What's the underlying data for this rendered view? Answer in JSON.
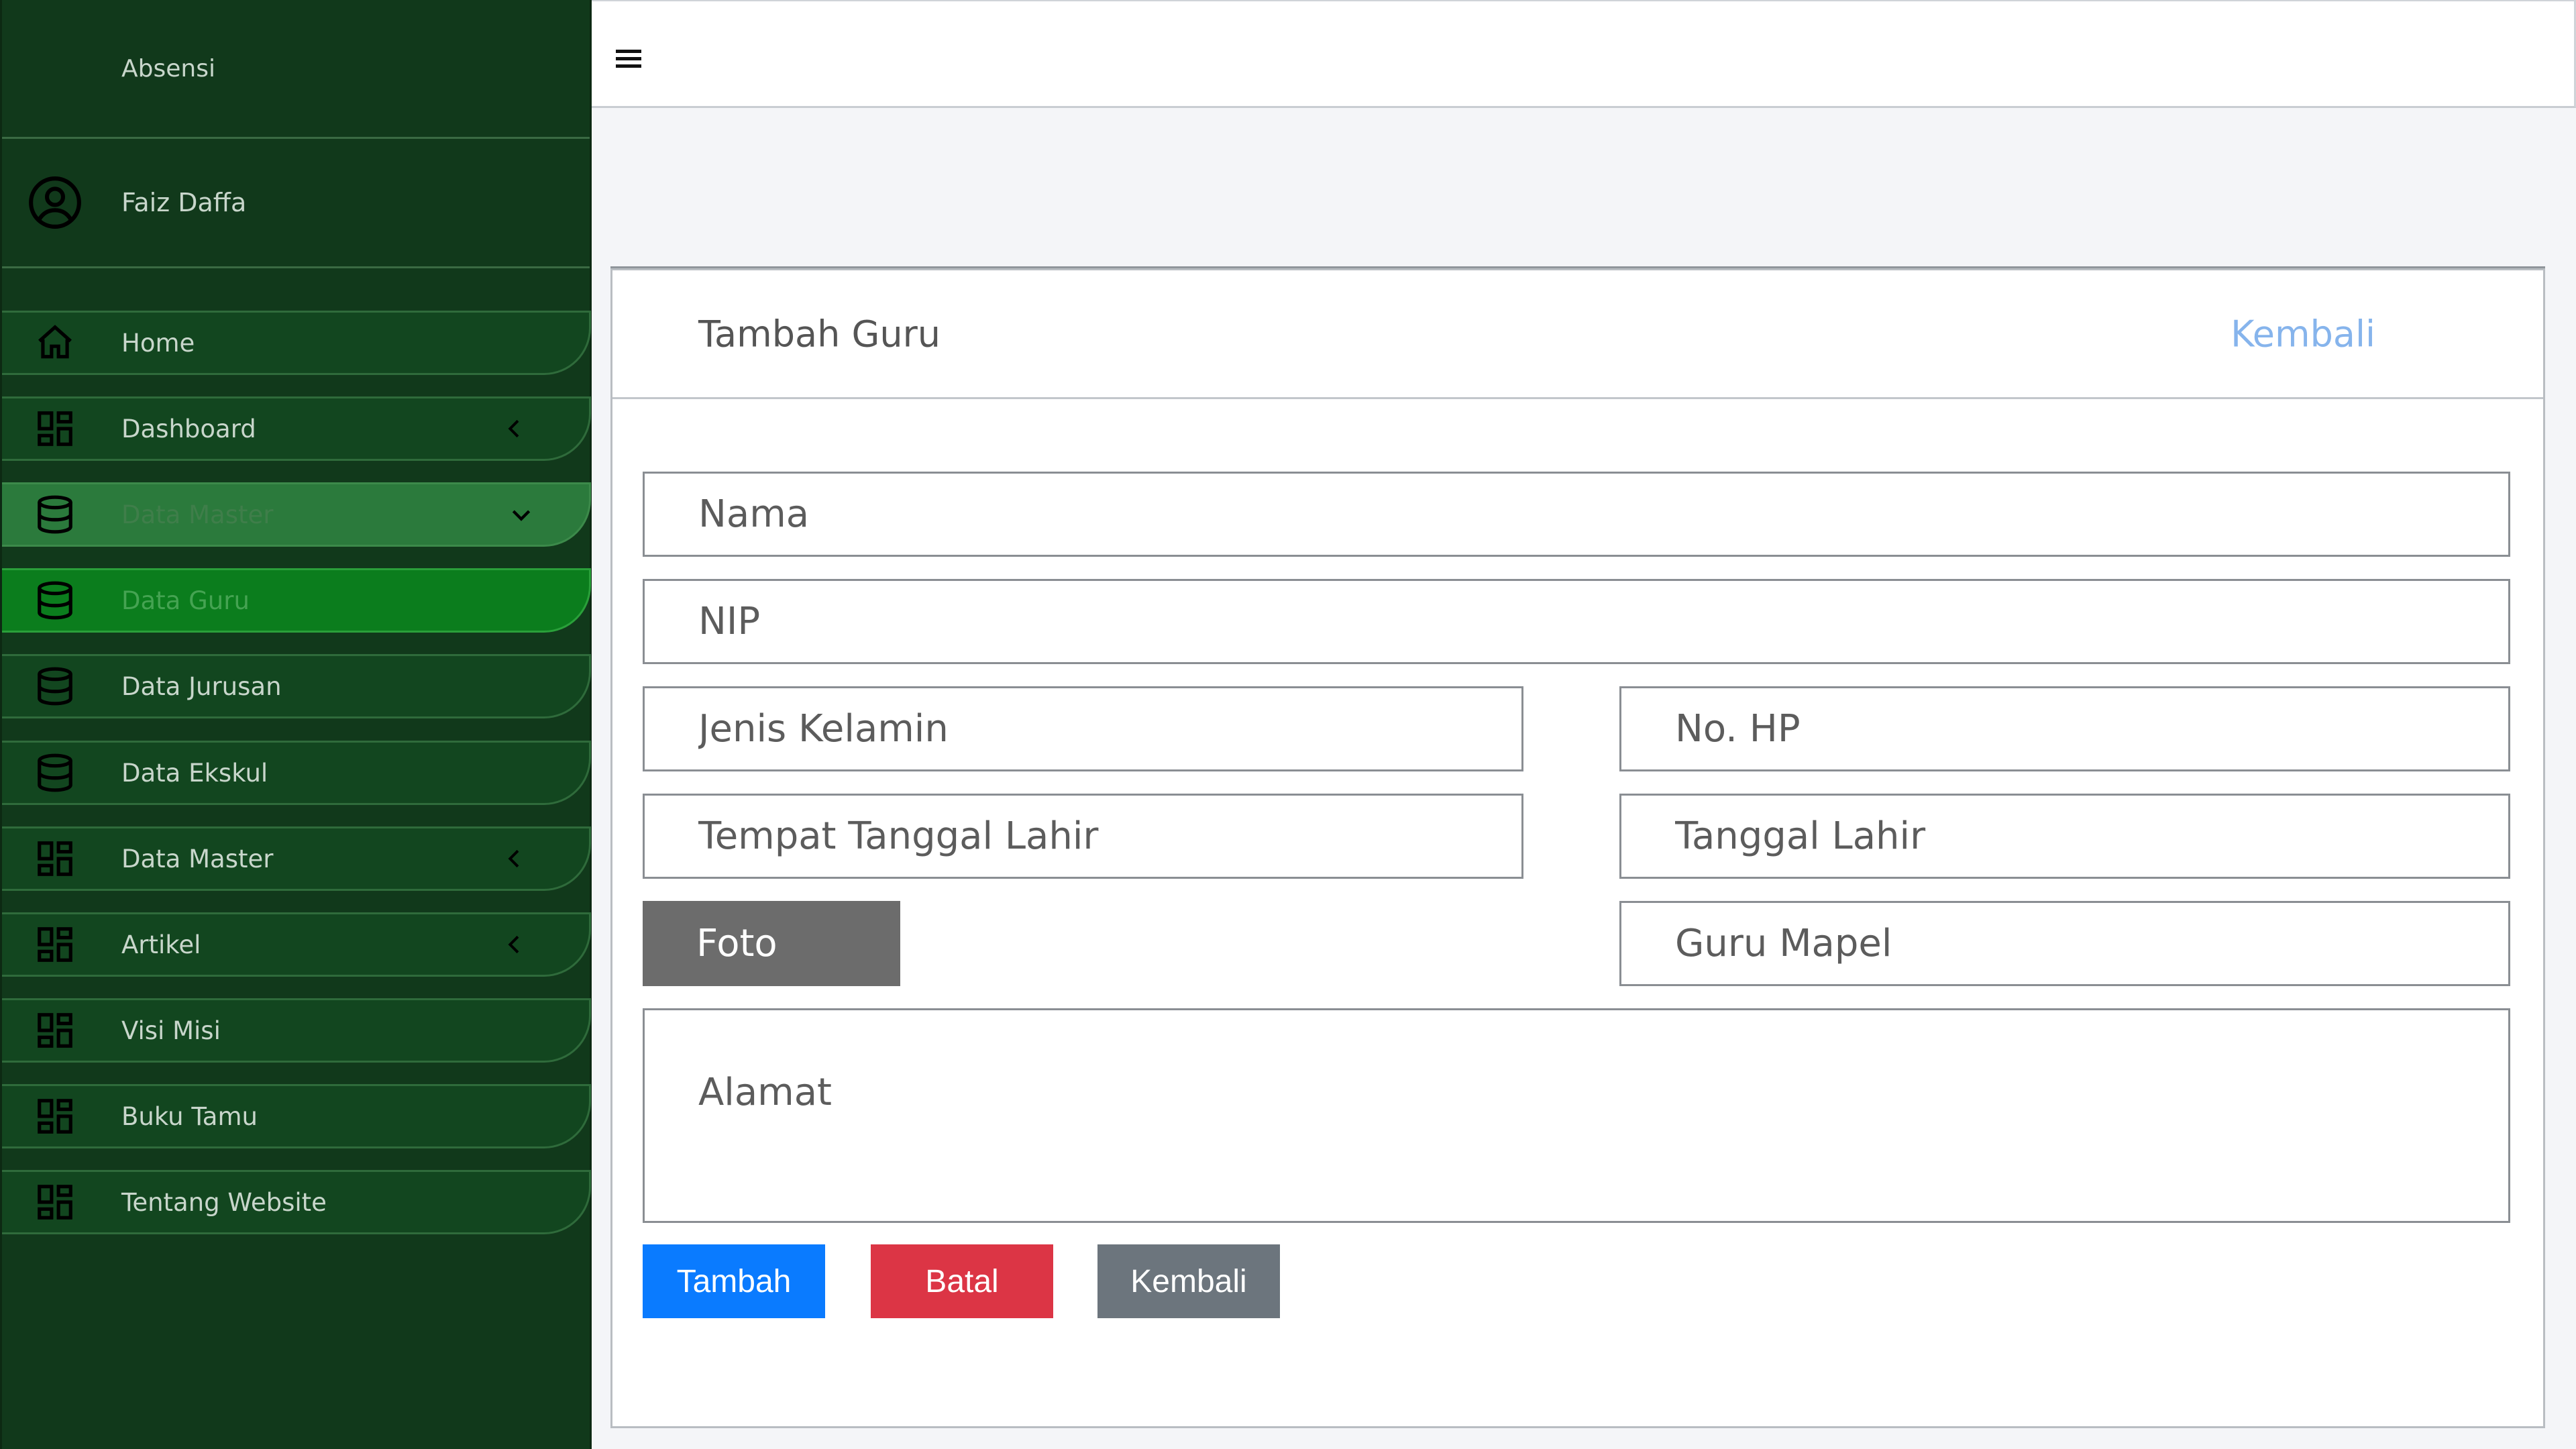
{
  "sidebar": {
    "brand": "Absensi",
    "user_name": "Faiz Daffa",
    "items": [
      {
        "label": "Home",
        "icon": "home-icon",
        "chevron": "none",
        "state": "normal"
      },
      {
        "label": "Dashboard",
        "icon": "grid-icon",
        "chevron": "left",
        "state": "normal"
      },
      {
        "label": "Data Master",
        "icon": "database-icon",
        "chevron": "down",
        "state": "expanded"
      },
      {
        "label": "Data Guru",
        "icon": "database-icon",
        "chevron": "none",
        "state": "active"
      },
      {
        "label": "Data Jurusan",
        "icon": "database-icon",
        "chevron": "none",
        "state": "normal"
      },
      {
        "label": "Data Ekskul",
        "icon": "database-icon",
        "chevron": "none",
        "state": "normal"
      },
      {
        "label": "Data Master",
        "icon": "grid-icon",
        "chevron": "left",
        "state": "normal"
      },
      {
        "label": "Artikel",
        "icon": "grid-icon",
        "chevron": "left",
        "state": "normal"
      },
      {
        "label": "Visi Misi",
        "icon": "grid-icon",
        "chevron": "none",
        "state": "normal"
      },
      {
        "label": "Buku Tamu",
        "icon": "grid-icon",
        "chevron": "none",
        "state": "normal"
      },
      {
        "label": "Tentang Website",
        "icon": "grid-icon",
        "chevron": "none",
        "state": "normal"
      }
    ]
  },
  "topbar": {
    "menu_icon": "hamburger-icon"
  },
  "card": {
    "title": "Tambah Guru",
    "back_link": "Kembali"
  },
  "form": {
    "nama_placeholder": "Nama",
    "nip_placeholder": "NIP",
    "jenis_kelamin_placeholder": "Jenis Kelamin",
    "no_hp_placeholder": "No. HP",
    "tempat_tanggal_lahir_placeholder": "Tempat Tanggal Lahir",
    "tanggal_lahir_placeholder": "Tanggal Lahir",
    "foto_label": "Foto",
    "guru_mapel_placeholder": "Guru Mapel",
    "alamat_placeholder": "Alamat"
  },
  "buttons": {
    "tambah": "Tambah",
    "batal": "Batal",
    "kembali": "Kembali"
  },
  "colors": {
    "sidebar_bg": "#11391b",
    "active_item": "#0b7d1d",
    "expanded_item": "#2b7a3c",
    "primary": "#0a7bff",
    "danger": "#dc3545",
    "secondary": "#6c757d",
    "link": "#86b4ec"
  }
}
